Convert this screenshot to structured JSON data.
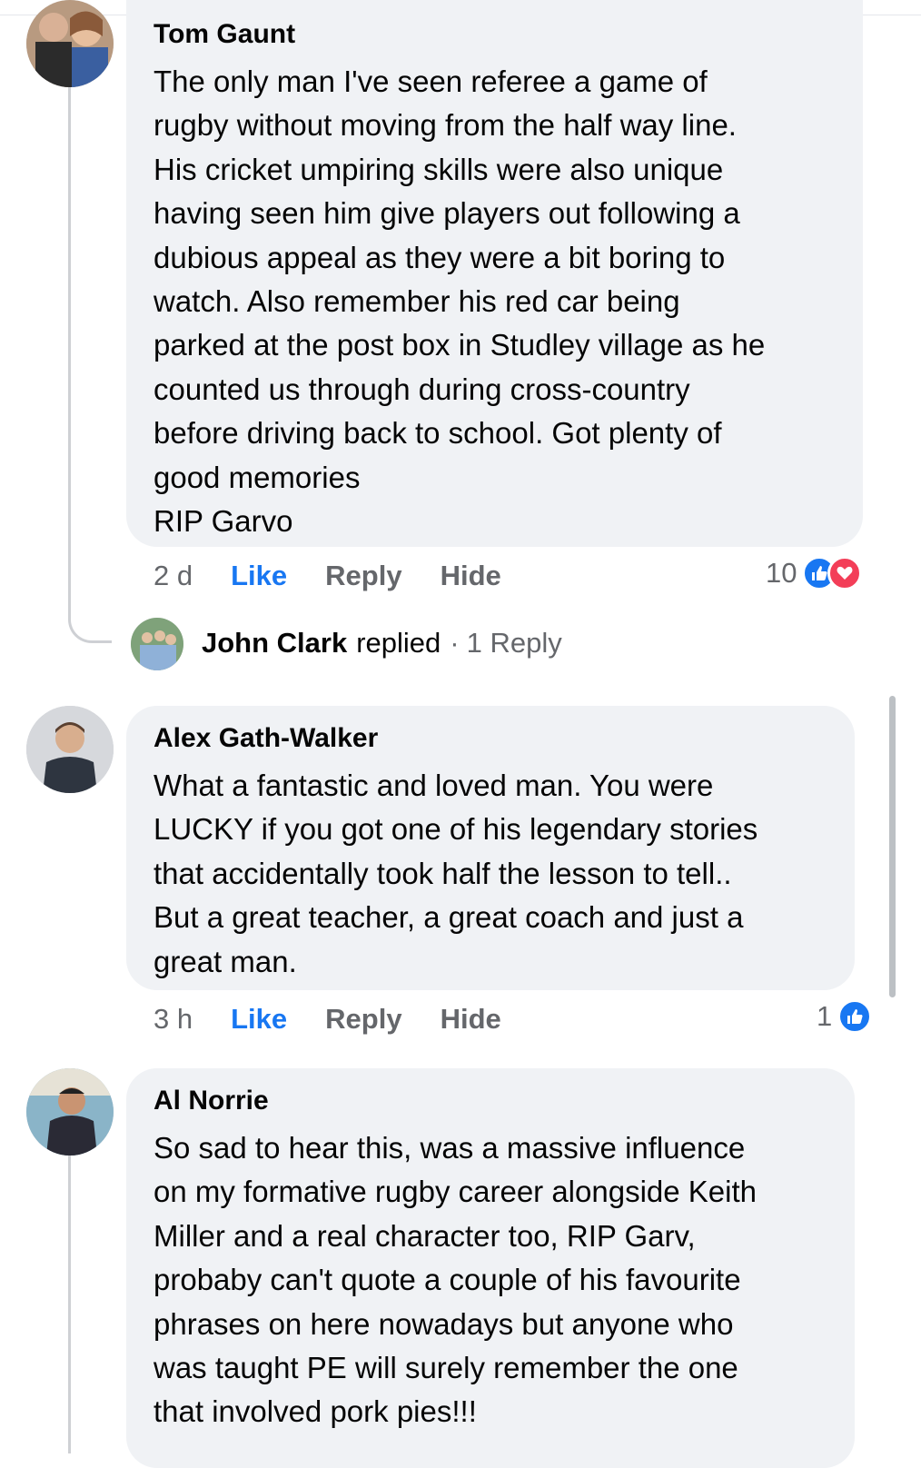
{
  "comments": [
    {
      "author": "Tom Gaunt",
      "text": "The only man I've seen referee a game of\nrugby without moving from the half way line.\nHis cricket umpiring skills were also unique\nhaving seen him give players out following a\ndubious appeal as they were a bit boring to\nwatch. Also remember his red car being\nparked at the post box in Studley village as he\ncounted us through during cross-country\nbefore driving back to school. Got plenty of\ngood memories\nRIP Garvo",
      "time": "2 d",
      "like": "Like",
      "reply": "Reply",
      "hide": "Hide",
      "reaction_count": "10",
      "reactions": [
        "like-icon",
        "love-icon"
      ]
    },
    {
      "author": "Alex Gath-Walker",
      "text": "What a fantastic and loved man. You were\nLUCKY if you got one of his legendary stories\nthat accidentally took half the lesson to tell..\nBut a great teacher, a great coach and just a\ngreat man.",
      "time": "3 h",
      "like": "Like",
      "reply": "Reply",
      "hide": "Hide",
      "reaction_count": "1",
      "reactions": [
        "like-icon"
      ]
    },
    {
      "author": "Al Norrie",
      "text": "So sad to hear this, was a massive influence\non my formative rugby career alongside Keith\nMiller and a real character too, RIP Garv,\nprobaby can't quote a couple of his favourite\nphrases on here nowadays but anyone who\nwas taught PE will surely remember the one\nthat involved pork pies!!!"
    }
  ],
  "reply_summary": {
    "name": "John Clark",
    "verb": "replied",
    "separator": "·",
    "count": "1 Reply"
  },
  "colors": {
    "link": "#1877f2",
    "muted": "#65676b",
    "bubble": "#f0f2f5",
    "love": "#f33e58"
  }
}
